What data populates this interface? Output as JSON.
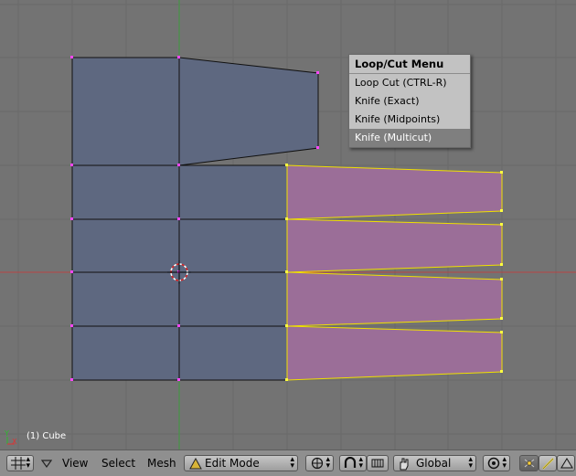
{
  "popup": {
    "title": "Loop/Cut Menu",
    "items": [
      {
        "label": "Loop Cut (CTRL-R)"
      },
      {
        "label": "Knife (Exact)"
      },
      {
        "label": "Knife (Midpoints)"
      },
      {
        "label": "Knife (Multicut)",
        "highlighted": true
      }
    ]
  },
  "viewport": {
    "object_label": "(1) Cube",
    "axis_y": "Y",
    "axis_x": "X",
    "colors": {
      "background": "#737373",
      "face": "#5d6781",
      "selected_face": "#9b6e98",
      "selected_edge": "#f0e000",
      "vertex": "#ff47ff",
      "axis_x": "#c23b3b",
      "axis_y": "#3aa23a"
    }
  },
  "header": {
    "menus": [
      "View",
      "Select",
      "Mesh"
    ],
    "mode_select": "Edit Mode",
    "orientation_select": "Global",
    "icons": [
      "editor-type-icon",
      "menu-collapse-icon",
      "draw-type-icon",
      "proportional-icon",
      "snap-icon",
      "transform-icon",
      "pivot-icon",
      "vertex-select-icon",
      "edge-select-icon",
      "face-select-icon"
    ]
  }
}
